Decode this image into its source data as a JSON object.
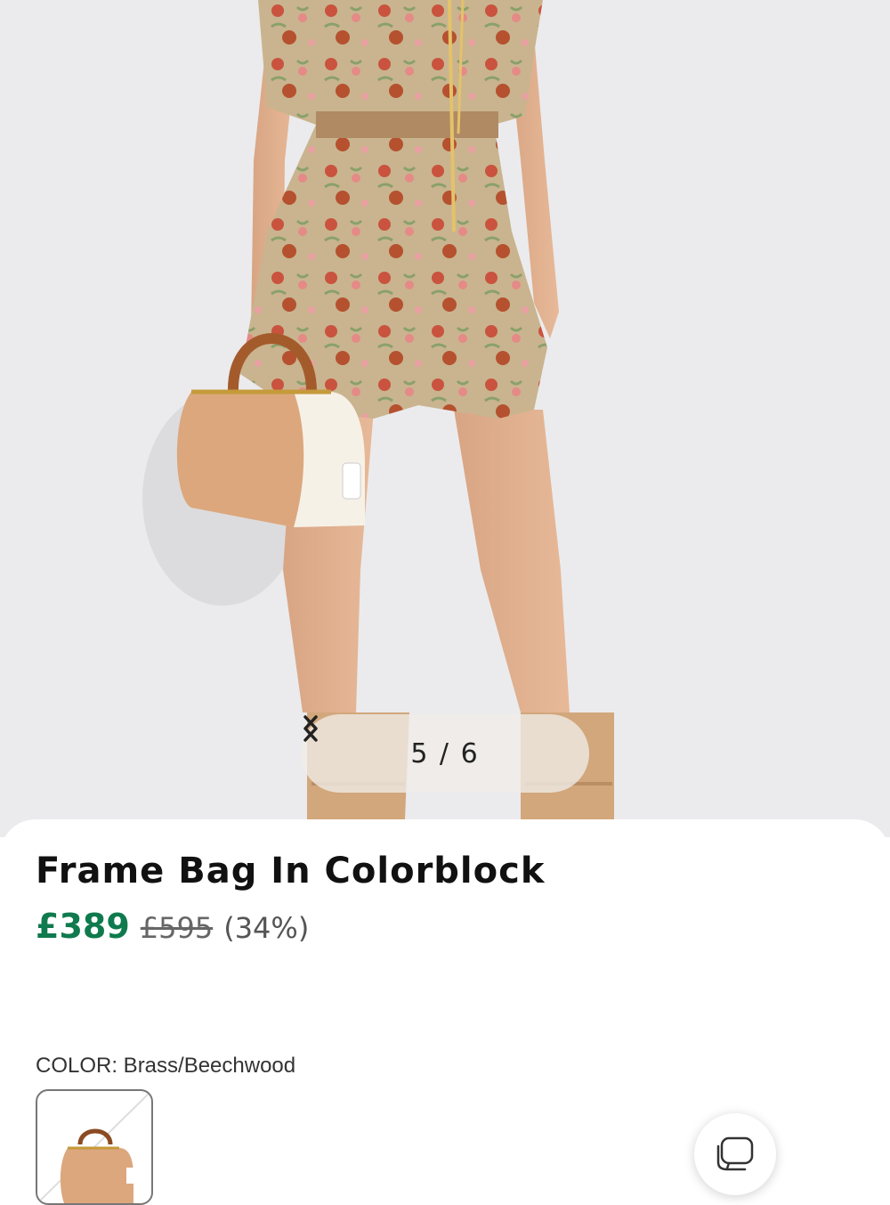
{
  "gallery": {
    "image_alt": "Model holding Frame Bag In Colorblock",
    "counter": "5 / 6",
    "prev_icon": "chevron-left-icon",
    "next_icon": "chevron-right-icon"
  },
  "product": {
    "title": "Frame Bag In Colorblock",
    "price_now": "£389",
    "price_was": "£595",
    "discount": "(34%)",
    "price_color": "#0f7a4d"
  },
  "color": {
    "label": "COLOR: Brass/Beechwood",
    "selected_swatch": "Brass/Beechwood"
  },
  "chat": {
    "icon": "chat-bubble-icon"
  }
}
